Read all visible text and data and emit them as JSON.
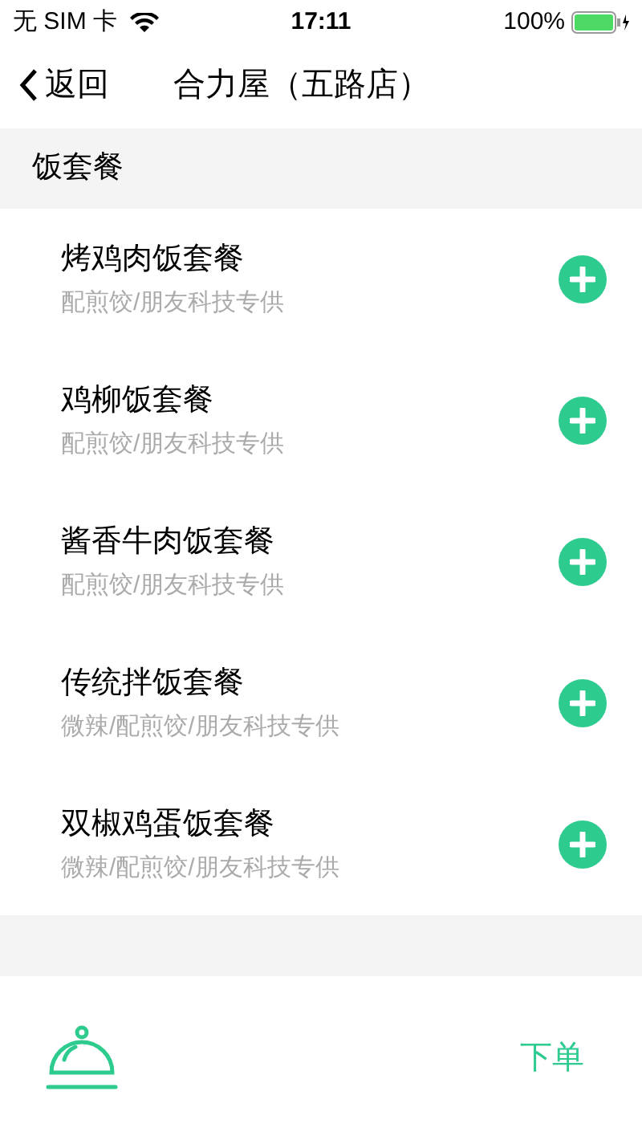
{
  "status_bar": {
    "carrier": "无 SIM 卡",
    "time": "17:11",
    "battery": "100%"
  },
  "nav": {
    "back": "返回",
    "title": "合力屋（五路店）"
  },
  "section": {
    "title": "饭套餐"
  },
  "items": [
    {
      "name": "烤鸡肉饭套餐",
      "note": "配煎饺/朋友科技专供"
    },
    {
      "name": "鸡柳饭套餐",
      "note": "配煎饺/朋友科技专供"
    },
    {
      "name": "酱香牛肉饭套餐",
      "note": "配煎饺/朋友科技专供"
    },
    {
      "name": "传统拌饭套餐",
      "note": "微辣/配煎饺/朋友科技专供"
    },
    {
      "name": "双椒鸡蛋饭套餐",
      "note": "微辣/配煎饺/朋友科技专供"
    }
  ],
  "bottom_bar": {
    "order_button": "下单"
  }
}
